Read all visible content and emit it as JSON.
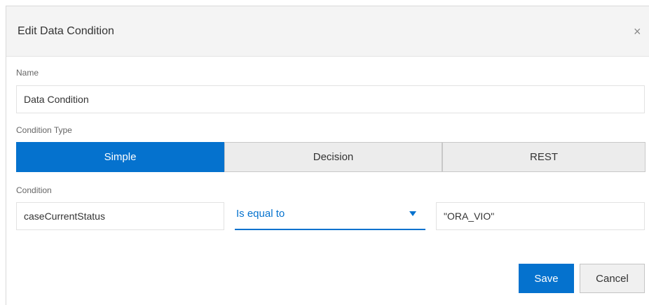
{
  "dialog": {
    "title": "Edit Data Condition",
    "close_icon": "×"
  },
  "name_field": {
    "label": "Name",
    "value": "Data Condition"
  },
  "condition_type": {
    "label": "Condition Type",
    "options": [
      "Simple",
      "Decision",
      "REST"
    ],
    "selected": "Simple"
  },
  "condition": {
    "label": "Condition",
    "variable": "caseCurrentStatus",
    "operator": "Is equal to",
    "value": "\"ORA_VIO\""
  },
  "footer": {
    "save_label": "Save",
    "cancel_label": "Cancel"
  },
  "colors": {
    "accent": "#0572ce",
    "header_bg": "#f4f4f4",
    "segment_inactive_bg": "#ececec"
  },
  "icons": {
    "close": "close-icon",
    "dropdown": "caret-down-icon"
  }
}
